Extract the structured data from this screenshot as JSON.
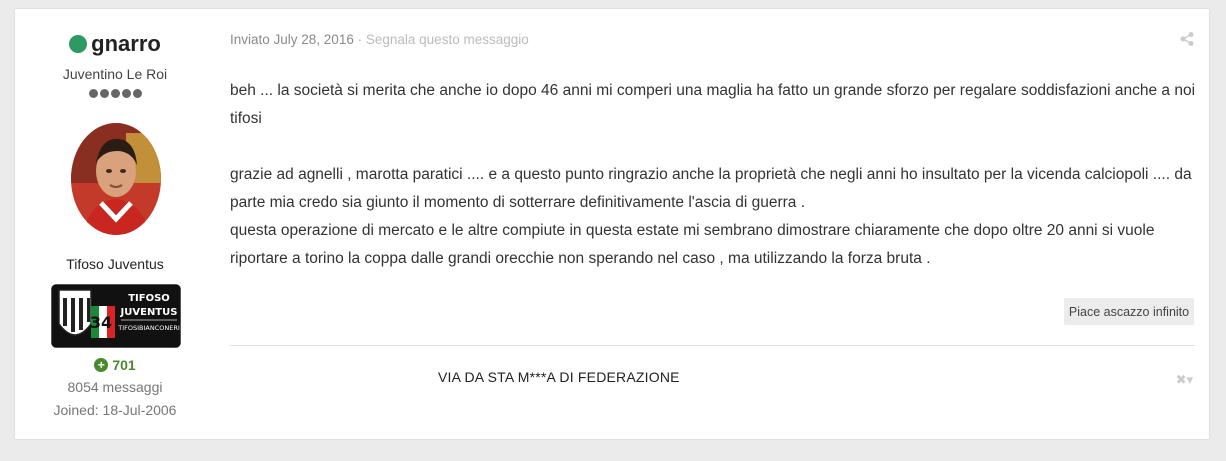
{
  "author": {
    "name": "gnarro",
    "title": "Juventino Le Roi",
    "group": "Tifoso Juventus",
    "reputation": "701",
    "post_count": "8054 messaggi",
    "joined": "Joined: 18-Jul-2006",
    "badge_lines": [
      "TIFOSO",
      "JUVENTUS",
      "TIFOSIBIANCONERI"
    ],
    "badge_number": "34"
  },
  "post": {
    "posted": "Inviato July 28, 2016",
    "separator": "·",
    "report_link": "Segnala questo messaggio",
    "paragraphs": [
      "beh ... la società si merita che anche io dopo 46 anni mi comperi una maglia  ha fatto un grande sforzo per regalare soddisfazioni anche a noi tifosi",
      "grazie ad agnelli , marotta paratici ....  e a questo punto ringrazio anche la proprietà che negli anni ho insultato per la vicenda calciopoli .... da parte mia credo sia giunto il momento di sotterrare definitivamente l'ascia di guerra .",
      "questa operazione di mercato e le altre compiute in questa estate mi sembrano dimostrare chiaramente che dopo oltre 20 anni si vuole riportare a torino la coppa dalle grandi orecchie non sperando nel caso , ma utilizzando la forza bruta ."
    ],
    "like_prefix": "Piace a ",
    "like_user": "scazzo infinito"
  },
  "signature": {
    "text": "VIA  DA STA M***A DI FEDERAZIONE"
  },
  "colors": {
    "online": "#2e9960",
    "reputation": "#4a8a2e"
  },
  "icons": {
    "share": "share-icon",
    "signature_toggle": "close-icon"
  }
}
